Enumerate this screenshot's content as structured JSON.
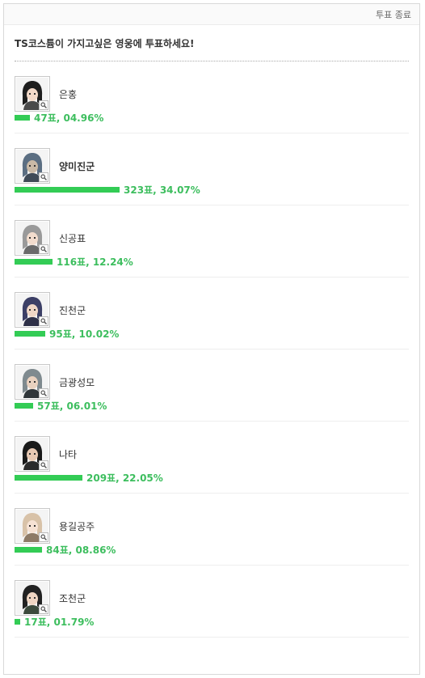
{
  "header": {
    "status_label": "투표 종료"
  },
  "poll": {
    "question": "TS코스튬이 가지고싶은 영웅에 투표하세요!",
    "options": [
      {
        "name": "은홍",
        "votes_text": "47표, 04.96%",
        "votes": 47,
        "percent": 4.96,
        "highlight": false,
        "avatar_icon": "hero-eunhong-portrait-icon"
      },
      {
        "name": "양미진군",
        "votes_text": "323표, 34.07%",
        "votes": 323,
        "percent": 34.07,
        "highlight": true,
        "avatar_icon": "hero-yangmijingun-portrait-icon"
      },
      {
        "name": "신공표",
        "votes_text": "116표, 12.24%",
        "votes": 116,
        "percent": 12.24,
        "highlight": false,
        "avatar_icon": "hero-singongpyo-portrait-icon"
      },
      {
        "name": "진천군",
        "votes_text": "95표, 10.02%",
        "votes": 95,
        "percent": 10.02,
        "highlight": false,
        "avatar_icon": "hero-jincheongun-portrait-icon"
      },
      {
        "name": "금광성모",
        "votes_text": "57표, 06.01%",
        "votes": 57,
        "percent": 6.01,
        "highlight": false,
        "avatar_icon": "hero-geumgwangseongmo-portrait-icon"
      },
      {
        "name": "나타",
        "votes_text": "209표, 22.05%",
        "votes": 209,
        "percent": 22.05,
        "highlight": false,
        "avatar_icon": "hero-nata-portrait-icon"
      },
      {
        "name": "용길공주",
        "votes_text": "84표, 08.86%",
        "votes": 84,
        "percent": 8.86,
        "highlight": false,
        "avatar_icon": "hero-yonggilgongju-portrait-icon"
      },
      {
        "name": "조천군",
        "votes_text": "17표, 01.79%",
        "votes": 17,
        "percent": 1.79,
        "highlight": false,
        "avatar_icon": "hero-jocheongun-portrait-icon"
      }
    ]
  },
  "colors": {
    "bar": "#33cc55",
    "vote_text": "#3dbe5e"
  }
}
